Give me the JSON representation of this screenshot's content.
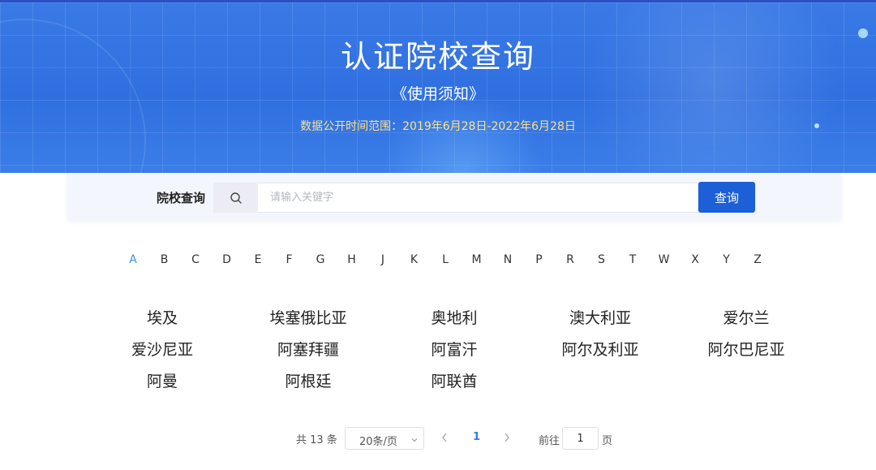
{
  "hero": {
    "title": "认证院校查询",
    "notice_link": "《使用须知》",
    "date_range": "数据公开时间范围：2019年6月28日-2022年6月28日"
  },
  "search": {
    "label": "院校查询",
    "placeholder": "请输入关键字",
    "value": "",
    "button_label": "查询"
  },
  "alphabet": {
    "active": "A",
    "letters": [
      "A",
      "B",
      "C",
      "D",
      "E",
      "F",
      "G",
      "H",
      "J",
      "K",
      "L",
      "M",
      "N",
      "P",
      "R",
      "S",
      "T",
      "W",
      "X",
      "Y",
      "Z"
    ]
  },
  "countries": [
    "埃及",
    "埃塞俄比亚",
    "奥地利",
    "澳大利亚",
    "爱尔兰",
    "爱沙尼亚",
    "阿塞拜疆",
    "阿富汗",
    "阿尔及利亚",
    "阿尔巴尼亚",
    "阿曼",
    "阿根廷",
    "阿联酋"
  ],
  "pagination": {
    "total_text": "共 13 条",
    "page_size": "20条/页",
    "current_page": "1",
    "goto_label": "前往",
    "goto_value": "1",
    "page_suffix": "页"
  },
  "icons": {
    "search": "search-icon",
    "prev": "chevron-left-icon",
    "next": "chevron-right-icon",
    "dropdown": "chevron-down-icon"
  },
  "colors": {
    "banner": "#2f6fe0",
    "button": "#1c5fd6",
    "active_letter": "#3d8cf0",
    "date_text": "#ffe08a"
  }
}
